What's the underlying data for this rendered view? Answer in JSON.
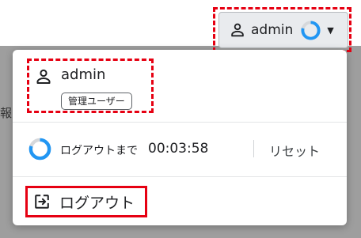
{
  "background": {
    "partial_text": "報の"
  },
  "header": {
    "user_button": {
      "username": "admin",
      "icon": "person-icon",
      "session_indicator": "progress-ring-icon",
      "dropdown_icon": "caret-down-icon"
    }
  },
  "menu": {
    "user": {
      "icon": "person-icon",
      "name": "admin",
      "role": "管理ユーザー"
    },
    "session": {
      "label": "ログアウトまで",
      "time": "00:03:58",
      "reset_label": "リセット"
    },
    "logout": {
      "icon": "logout-icon",
      "label": "ログアウト"
    }
  },
  "colors": {
    "accent": "#2196f3",
    "ring_track": "#d6d8db",
    "highlight": "#e60012"
  }
}
